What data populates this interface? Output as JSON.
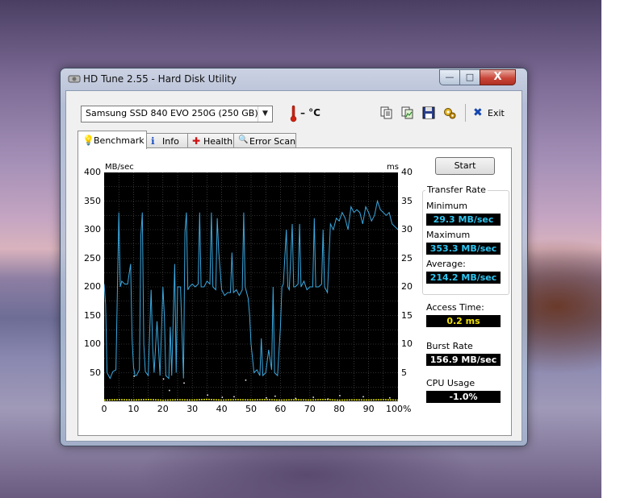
{
  "window": {
    "title": "HD Tune 2.55 - Hard Disk Utility",
    "min_glyph": "—",
    "max_glyph": "□",
    "close_glyph": "X"
  },
  "toolbar": {
    "drive": "Samsung SSD 840 EVO 250G (250 GB)",
    "dropdown_arrow": "▼",
    "temperature": "– °C",
    "exit_label": "Exit",
    "exit_glyph": "✖"
  },
  "tabs": [
    {
      "label": "Benchmark",
      "icon": "lightbulb-icon",
      "glyph": "💡"
    },
    {
      "label": "Info",
      "icon": "info-icon",
      "glyph": "ℹ"
    },
    {
      "label": "Health",
      "icon": "health-cross-icon",
      "glyph": "✚"
    },
    {
      "label": "Error Scan",
      "icon": "magnifier-icon",
      "glyph": "🔍"
    }
  ],
  "benchmark": {
    "start_label": "Start",
    "transfer_rate": {
      "legend": "Transfer Rate",
      "minimum_label": "Minimum",
      "minimum_value": "29.3 MB/sec",
      "maximum_label": "Maximum",
      "maximum_value": "353.3 MB/sec",
      "average_label": "Average:",
      "average_value": "214.2 MB/sec"
    },
    "access_time_label": "Access Time:",
    "access_time_value": "0.2 ms",
    "burst_rate_label": "Burst Rate",
    "burst_rate_value": "156.9 MB/sec",
    "cpu_usage_label": "CPU Usage",
    "cpu_usage_value": "-1.0%"
  },
  "colors": {
    "graph_background": "#000000",
    "grid": "#5a5a5a",
    "transfer_line": "#3aa8e0",
    "access_dots": "#ffffff",
    "cpu_line": "#f0f000",
    "cyan_value": "#2ec4f0",
    "yellow_value": "#f0e000"
  },
  "chart_data": {
    "type": "line",
    "ylabel": "MB/sec",
    "y2label": "ms",
    "ylim": [
      0,
      400
    ],
    "y2lim": [
      0,
      40
    ],
    "xlim": [
      0,
      100
    ],
    "x_unit": "%",
    "y_ticks": [
      "400",
      "350",
      "300",
      "250",
      "200",
      "150",
      "100",
      "50"
    ],
    "y2_ticks": [
      "40",
      "35",
      "30",
      "25",
      "20",
      "15",
      "10",
      "5"
    ],
    "x_ticks": [
      "0",
      "10",
      "20",
      "30",
      "40",
      "50",
      "60",
      "70",
      "80",
      "90",
      "100%"
    ],
    "grid": true,
    "series": [
      {
        "kind": "transfer",
        "points": [
          [
            0,
            205
          ],
          [
            0.5,
            170
          ],
          [
            1,
            50
          ],
          [
            2,
            40
          ],
          [
            3,
            52
          ],
          [
            4,
            55
          ],
          [
            5,
            330
          ],
          [
            5.5,
            200
          ],
          [
            6,
            210
          ],
          [
            7,
            205
          ],
          [
            8,
            205
          ],
          [
            9,
            240
          ],
          [
            9.5,
            110
          ],
          [
            10,
            60
          ],
          [
            10.5,
            45
          ],
          [
            11,
            45
          ],
          [
            12,
            55
          ],
          [
            12.5,
            290
          ],
          [
            13,
            330
          ],
          [
            13.5,
            100
          ],
          [
            14,
            52
          ],
          [
            15,
            45
          ],
          [
            16,
            195
          ],
          [
            16.5,
            95
          ],
          [
            17,
            50
          ],
          [
            18,
            140
          ],
          [
            18.5,
            95
          ],
          [
            19,
            45
          ],
          [
            20,
            200
          ],
          [
            20.5,
            150
          ],
          [
            21,
            45
          ],
          [
            22,
            40
          ],
          [
            22.5,
            130
          ],
          [
            23,
            45
          ],
          [
            24,
            240
          ],
          [
            24.5,
            50
          ],
          [
            25,
            200
          ],
          [
            26,
            200
          ],
          [
            27,
            40
          ],
          [
            27.5,
            295
          ],
          [
            28,
            330
          ],
          [
            28.5,
            195
          ],
          [
            29,
            200
          ],
          [
            30,
            205
          ],
          [
            31,
            200
          ],
          [
            32,
            205
          ],
          [
            32.5,
            330
          ],
          [
            33,
            200
          ],
          [
            34,
            200
          ],
          [
            35,
            210
          ],
          [
            36,
            205
          ],
          [
            36.5,
            330
          ],
          [
            37,
            200
          ],
          [
            38,
            195
          ],
          [
            38.5,
            320
          ],
          [
            39,
            260
          ],
          [
            40,
            195
          ],
          [
            41,
            185
          ],
          [
            42,
            190
          ],
          [
            43,
            190
          ],
          [
            43.5,
            260
          ],
          [
            44,
            190
          ],
          [
            45,
            195
          ],
          [
            46,
            185
          ],
          [
            47,
            195
          ],
          [
            47.5,
            330
          ],
          [
            48,
            200
          ],
          [
            49,
            180
          ],
          [
            49.5,
            150
          ],
          [
            50,
            100
          ],
          [
            51,
            50
          ],
          [
            52,
            55
          ],
          [
            53,
            45
          ],
          [
            53.5,
            110
          ],
          [
            54,
            45
          ],
          [
            55,
            50
          ],
          [
            56,
            90
          ],
          [
            57,
            55
          ],
          [
            57.5,
            200
          ],
          [
            58,
            50
          ],
          [
            59,
            45
          ],
          [
            60,
            130
          ],
          [
            60.5,
            200
          ],
          [
            61,
            205
          ],
          [
            62,
            300
          ],
          [
            62.5,
            200
          ],
          [
            63,
            195
          ],
          [
            64,
            310
          ],
          [
            64.5,
            200
          ],
          [
            65,
            200
          ],
          [
            66,
            205
          ],
          [
            66.5,
            310
          ],
          [
            67,
            200
          ],
          [
            68,
            210
          ],
          [
            69,
            195
          ],
          [
            70,
            200
          ],
          [
            71,
            200
          ],
          [
            71.5,
            320
          ],
          [
            72,
            200
          ],
          [
            73,
            200
          ],
          [
            74,
            205
          ],
          [
            74.5,
            300
          ],
          [
            75,
            200
          ],
          [
            76,
            190
          ],
          [
            76.5,
            250
          ],
          [
            77,
            310
          ],
          [
            78,
            300
          ],
          [
            79,
            320
          ],
          [
            80,
            315
          ],
          [
            81,
            330
          ],
          [
            82,
            320
          ],
          [
            83,
            300
          ],
          [
            84,
            340
          ],
          [
            85,
            330
          ],
          [
            86,
            335
          ],
          [
            87,
            330
          ],
          [
            88,
            310
          ],
          [
            89,
            340
          ],
          [
            90,
            330
          ],
          [
            91,
            315
          ],
          [
            92,
            325
          ],
          [
            93,
            350
          ],
          [
            94,
            335
          ],
          [
            95,
            330
          ],
          [
            96,
            325
          ],
          [
            97,
            330
          ],
          [
            98,
            310
          ],
          [
            99,
            305
          ],
          [
            100,
            300
          ]
        ]
      },
      {
        "kind": "access_time",
        "points": [
          [
            10,
            4.5
          ],
          [
            20,
            4
          ],
          [
            22,
            2
          ],
          [
            27,
            3.3
          ],
          [
            35,
            1.2
          ],
          [
            40,
            0.8
          ],
          [
            44,
            0.9
          ],
          [
            48,
            3.8
          ],
          [
            55,
            0.7
          ],
          [
            58,
            1
          ],
          [
            65,
            0.6
          ],
          [
            71,
            0.8
          ],
          [
            76,
            0.5
          ],
          [
            80,
            1.1
          ],
          [
            88,
            0.9
          ],
          [
            97,
            0.7
          ]
        ]
      },
      {
        "kind": "cpu_usage",
        "points": [
          [
            0,
            0.5
          ],
          [
            5,
            1.0
          ],
          [
            10,
            0.6
          ],
          [
            15,
            1.2
          ],
          [
            20,
            0.4
          ],
          [
            25,
            0.9
          ],
          [
            30,
            0.6
          ],
          [
            35,
            1.4
          ],
          [
            40,
            0.5
          ],
          [
            45,
            1.0
          ],
          [
            50,
            0.7
          ],
          [
            55,
            1.1
          ],
          [
            60,
            0.5
          ],
          [
            65,
            0.9
          ],
          [
            70,
            0.6
          ],
          [
            75,
            1.2
          ],
          [
            80,
            0.4
          ],
          [
            85,
            0.8
          ],
          [
            90,
            0.6
          ],
          [
            95,
            1.0
          ],
          [
            100,
            0.5
          ]
        ]
      }
    ]
  }
}
